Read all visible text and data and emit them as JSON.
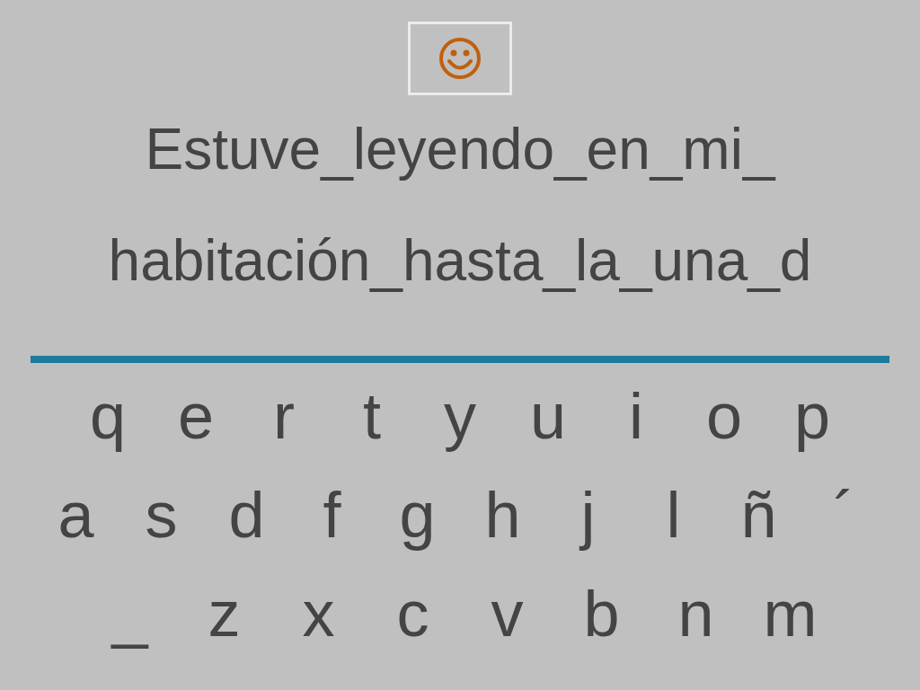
{
  "sentence_lines": [
    "Estuve_leyendo_en_mi_",
    "habitación_hasta_la_una_d"
  ],
  "keyboard_rows": [
    [
      "q",
      "e",
      "r",
      "t",
      "y",
      "u",
      "i",
      "o",
      "p"
    ],
    [
      "a",
      "s",
      "d",
      "f",
      "g",
      "h",
      "j",
      "l",
      "ñ",
      "´"
    ],
    [
      "_",
      "z",
      "x",
      "c",
      "v",
      "b",
      "n",
      "m"
    ]
  ]
}
